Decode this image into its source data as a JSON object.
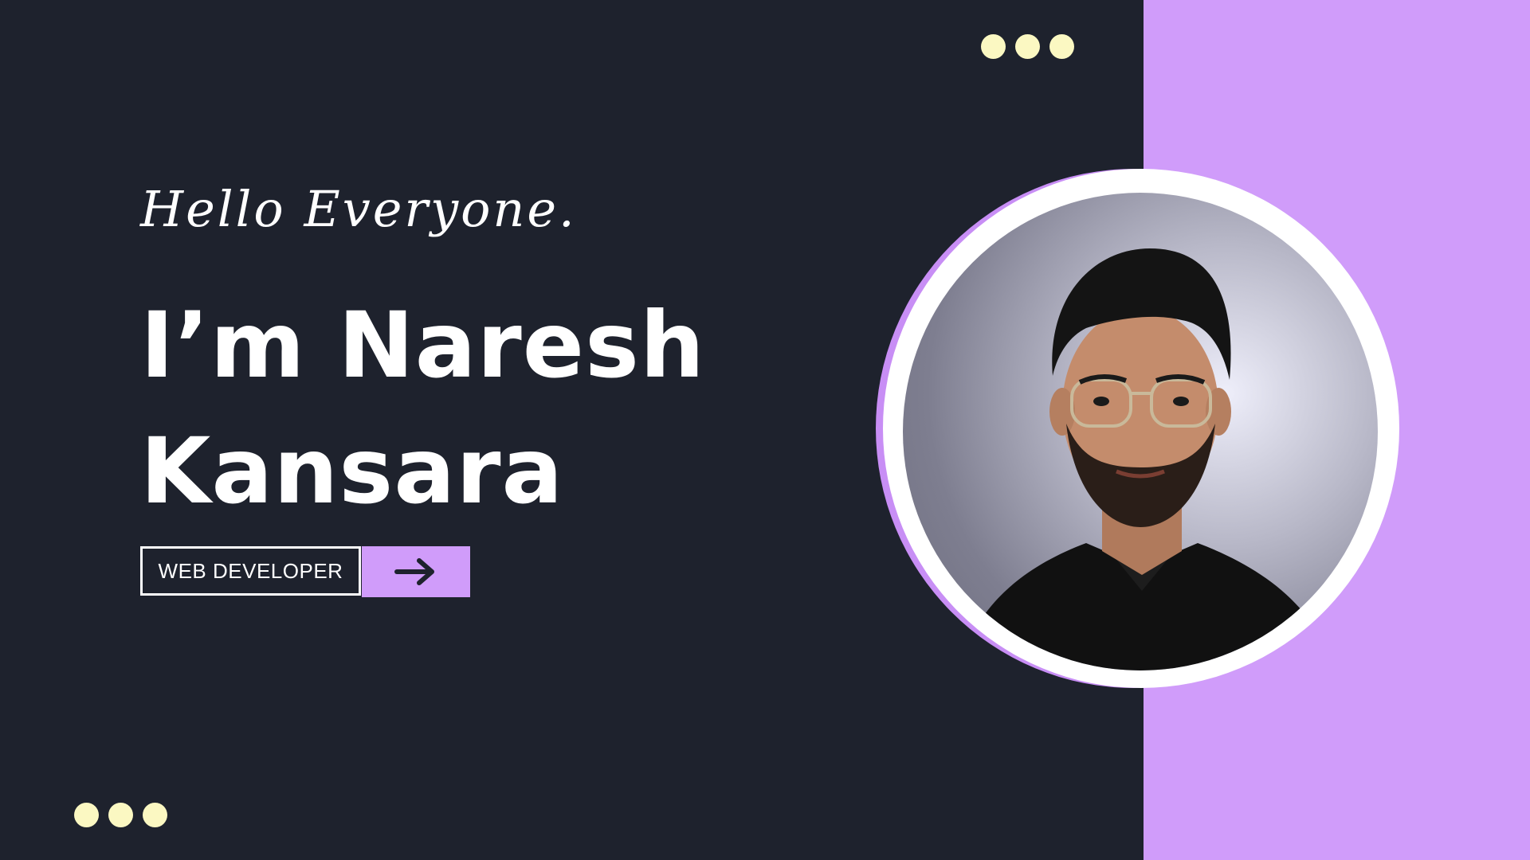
{
  "greeting": "Hello Everyone.",
  "name_line_1": "I’m Naresh",
  "name_line_2": "Kansara",
  "role_label": "WEB DEVELOPER",
  "icons": {
    "arrow": "arrow-right-icon",
    "dots": "three-dots-icon"
  },
  "colors": {
    "dark_background": "#1e222d",
    "accent_purple": "#d09cfa",
    "dot_yellow": "#fbf8c2",
    "text_white": "#ffffff"
  }
}
